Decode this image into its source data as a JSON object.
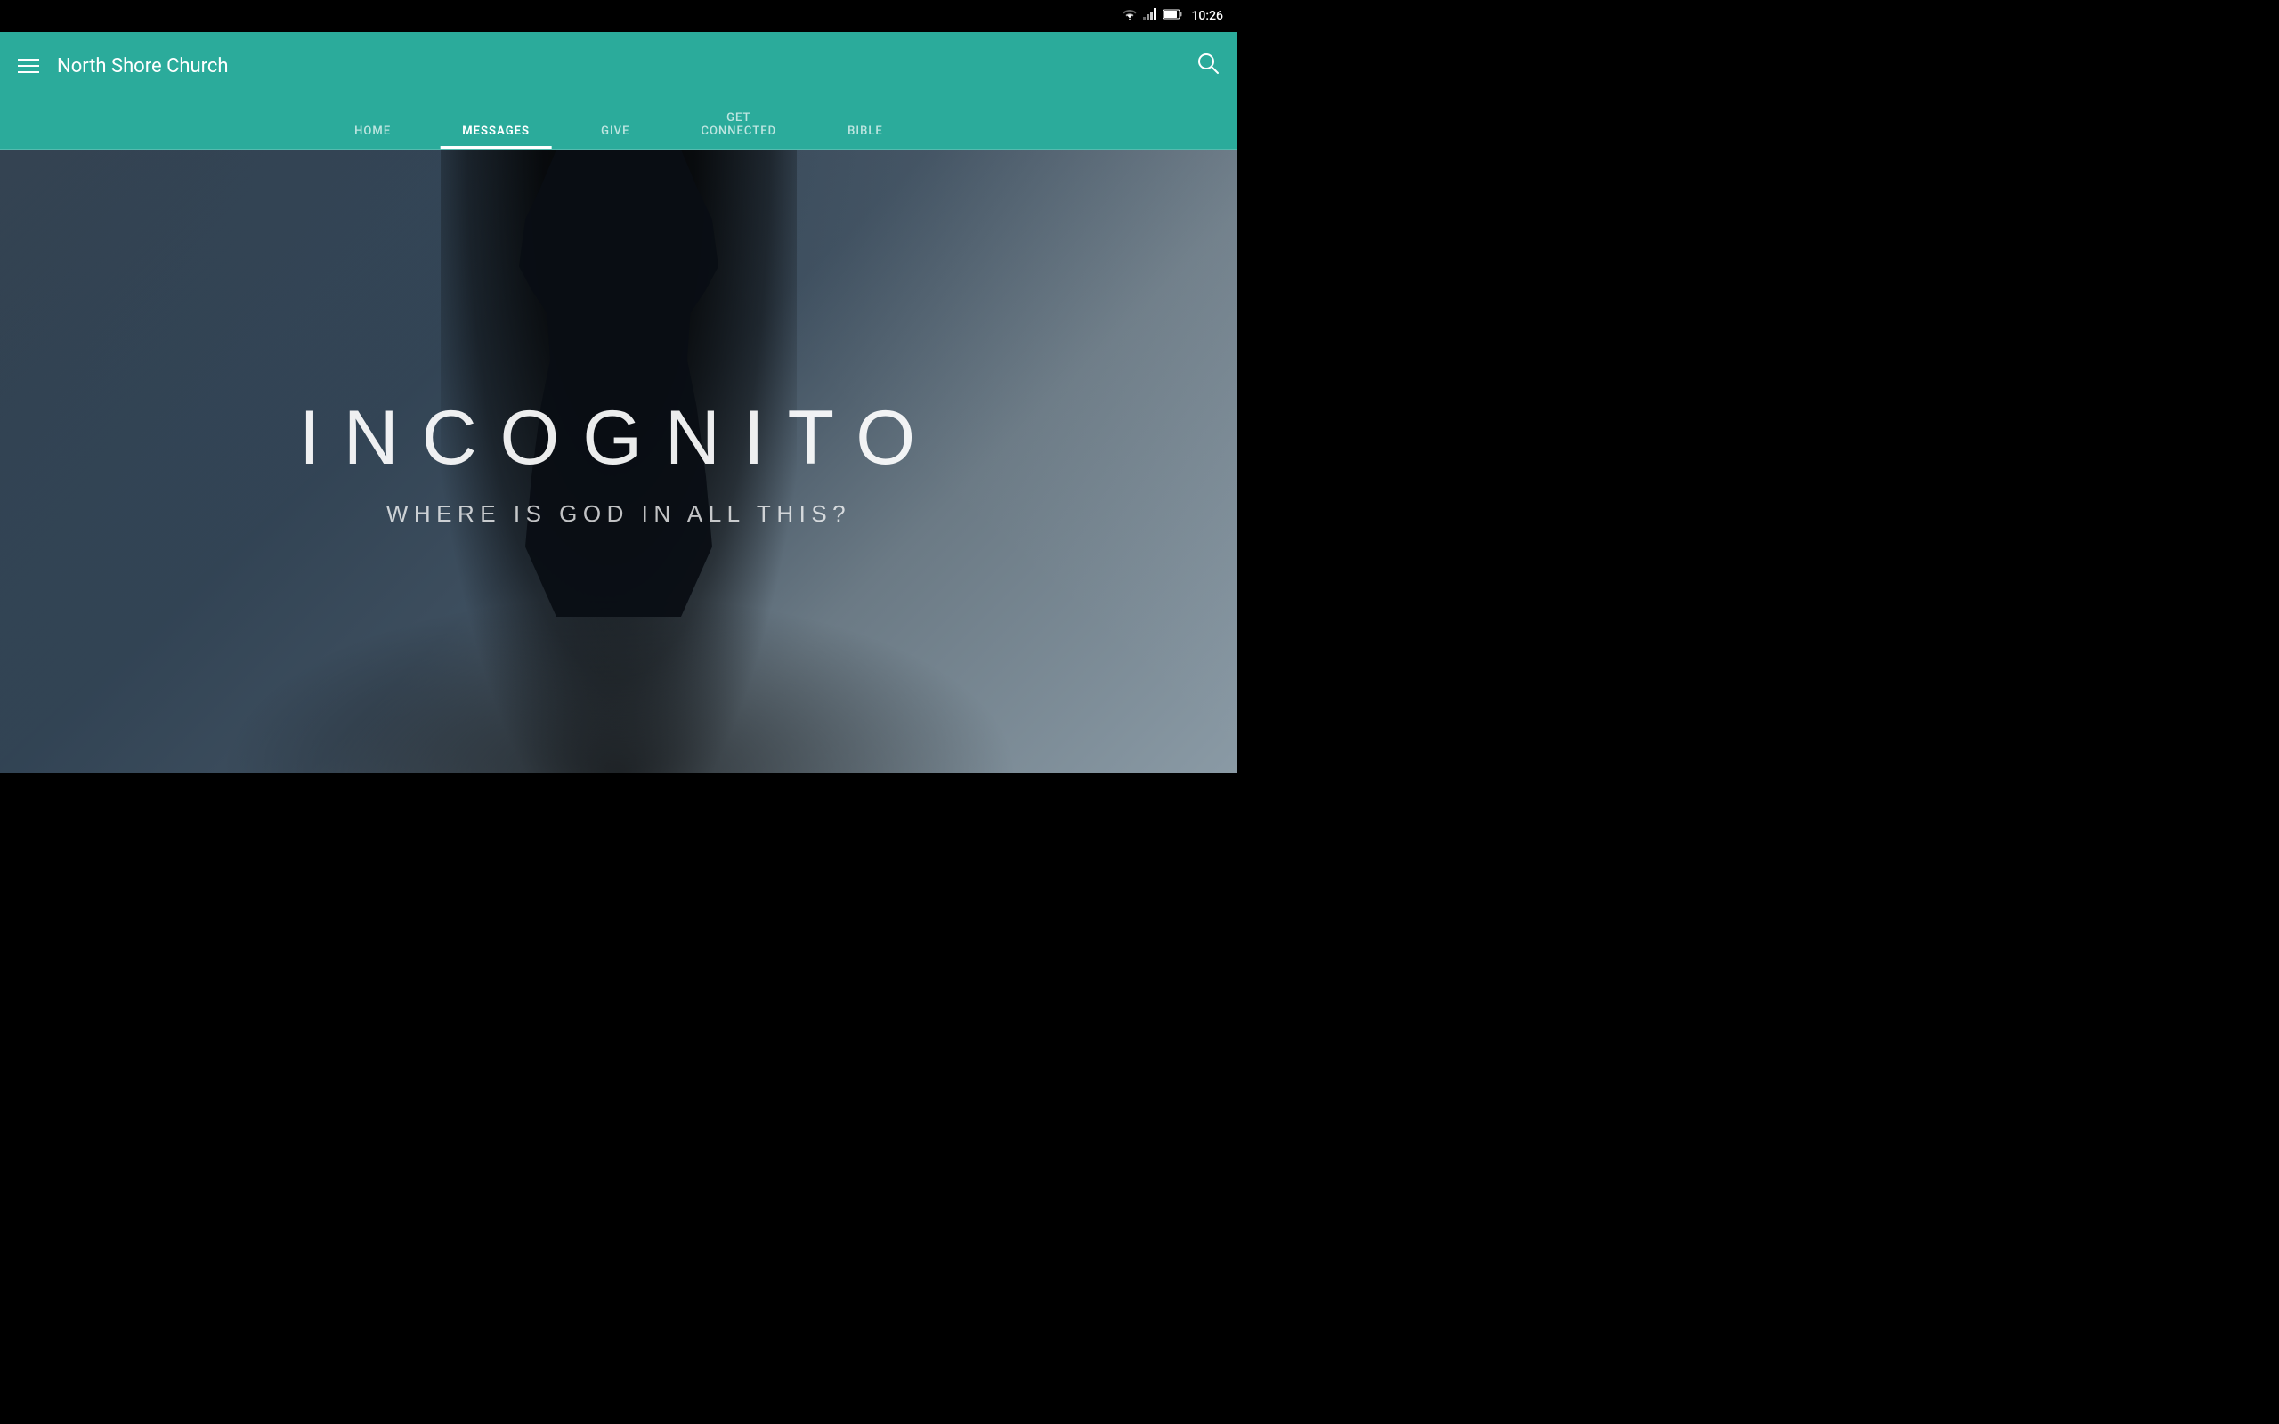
{
  "statusBar": {
    "time": "10:26"
  },
  "appBar": {
    "title": "North Shore Church",
    "menuIcon": "menu",
    "searchIcon": "search"
  },
  "navTabs": {
    "items": [
      {
        "label": "HOME",
        "active": false
      },
      {
        "label": "MESSAGES",
        "active": true
      },
      {
        "label": "GIVE",
        "active": false
      },
      {
        "label": "GET\nCONNECTED",
        "active": false
      },
      {
        "label": "BIBLE",
        "active": false
      }
    ]
  },
  "hero": {
    "title": "INCOGNITO",
    "subtitle": "WHERE IS GOD IN ALL THIS?"
  }
}
